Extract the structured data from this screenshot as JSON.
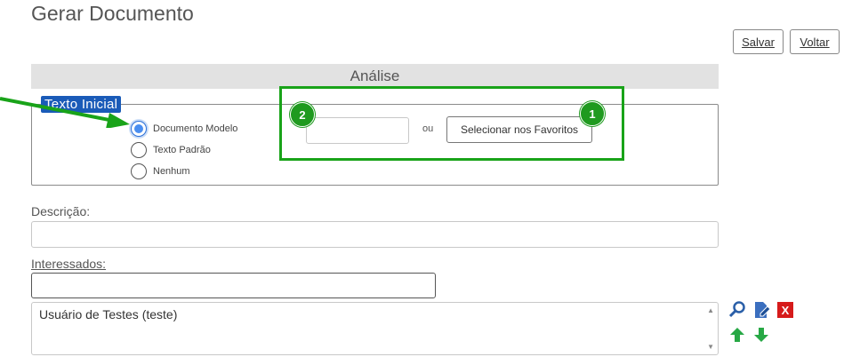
{
  "page": {
    "title": "Gerar Documento"
  },
  "toolbar": {
    "save_label": "Salvar",
    "back_label": "Voltar"
  },
  "section": {
    "title": "Análise"
  },
  "texto_inicial": {
    "legend": "Texto Inicial",
    "options": [
      {
        "label": "Documento Modelo",
        "selected": true
      },
      {
        "label": "Texto Padrão",
        "selected": false
      },
      {
        "label": "Nenhum",
        "selected": false
      }
    ],
    "document_number_value": "",
    "or_label": "ou",
    "favorites_button": "Selecionar nos Favoritos"
  },
  "annotations": {
    "badge_1": "1",
    "badge_2": "2",
    "highlight_color": "#19a319"
  },
  "descricao": {
    "label": "Descrição:",
    "value": ""
  },
  "interessados": {
    "label": "Interessados:",
    "input_value": "",
    "list": [
      "Usuário de Testes (teste)"
    ]
  },
  "icons": [
    "search-icon",
    "edit-icon",
    "remove-icon",
    "move-up-icon",
    "move-down-icon",
    "arrow-pointer-icon"
  ]
}
